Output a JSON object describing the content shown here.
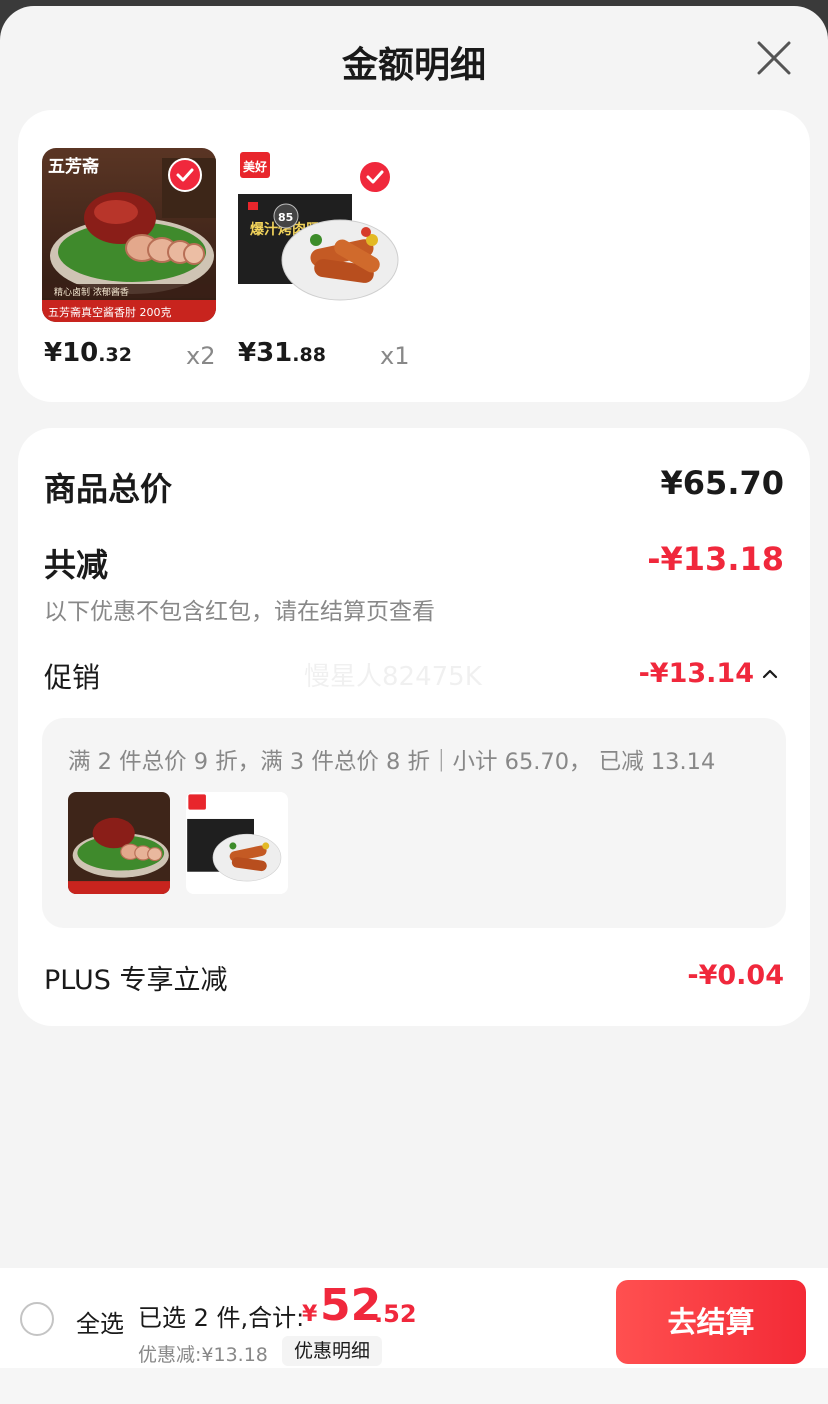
{
  "header": {
    "title": "金额明细"
  },
  "products": [
    {
      "brand": "五芳斋",
      "banner_text": "五芳斋真空酱香肘 200克",
      "slogan": "精心卤制 浓郁酱香",
      "price_int": "¥10",
      "price_dec": ".32",
      "qty": "x2"
    },
    {
      "brand": "美好",
      "box_text": "爆汁烤肉肠",
      "badge": "85",
      "price_int": "¥31",
      "price_dec": ".88",
      "qty": "x1"
    }
  ],
  "summary": {
    "total_label": "商品总价",
    "total_value": "¥65.70",
    "discount_label": "共减",
    "discount_value": "-¥13.18",
    "discount_note": "以下优惠不包含红包，请在结算页查看",
    "promo_label": "促销",
    "promo_value": "-¥13.14",
    "watermark": "慢星人82475K",
    "promo_detail": "满 2 件总价 9 折，满 3 件总价 8 折｜小计 65.70， 已减 13.14",
    "plus_label": "PLUS 专享立减",
    "plus_value": "-¥0.04"
  },
  "footer": {
    "select_all": "全选",
    "selected_text": "已选 2 件,合计:",
    "total_yen": "¥",
    "total_int": "52",
    "total_dec": ".52",
    "discount_text": "优惠减:¥13.18",
    "detail_button": "优惠明细",
    "checkout_button": "去结算"
  },
  "colors": {
    "accent": "#f0283c",
    "text": "#1a1a1a",
    "muted": "#888888"
  }
}
